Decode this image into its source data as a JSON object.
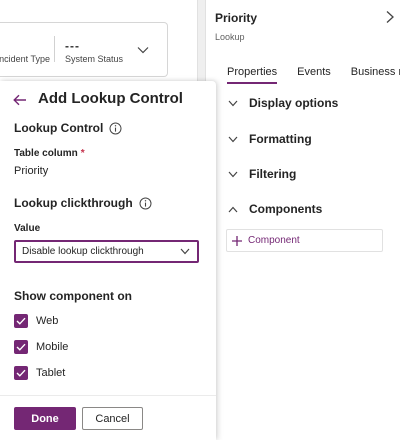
{
  "background": {
    "incident_type_label": "Incident Type",
    "system_status_value": "---",
    "system_status_label": "System Status"
  },
  "properties_pane": {
    "title": "Priority",
    "subtitle": "Lookup",
    "tabs": [
      {
        "label": "Properties",
        "active": true
      },
      {
        "label": "Events",
        "active": false
      },
      {
        "label": "Business rules",
        "active": false
      }
    ],
    "sections": [
      {
        "label": "Display options",
        "expanded": false
      },
      {
        "label": "Formatting",
        "expanded": false
      },
      {
        "label": "Filtering",
        "expanded": false
      },
      {
        "label": "Components",
        "expanded": true
      }
    ],
    "add_component_label": "Component"
  },
  "panel": {
    "title": "Add Lookup Control",
    "lookup_control_heading": "Lookup Control",
    "table_column_label": "Table column",
    "table_column_required": "*",
    "table_column_value": "Priority",
    "clickthrough_heading": "Lookup clickthrough",
    "value_label": "Value",
    "value_selected": "Disable lookup clickthrough",
    "show_on_heading": "Show component on",
    "show_on_options": [
      {
        "label": "Web",
        "checked": true
      },
      {
        "label": "Mobile",
        "checked": true
      },
      {
        "label": "Tablet",
        "checked": true
      }
    ],
    "done_label": "Done",
    "cancel_label": "Cancel"
  },
  "colors": {
    "accent": "#742774",
    "required": "#c4314b",
    "text": "#242424",
    "muted": "#616161"
  }
}
